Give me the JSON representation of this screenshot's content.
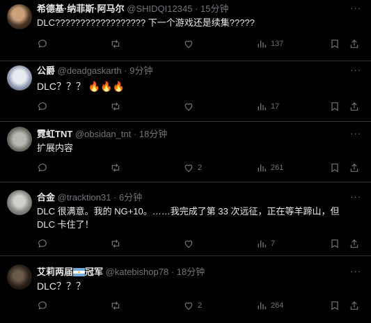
{
  "tweets": [
    {
      "name": "希德基·纳菲斯·阿马尔",
      "handle": "@SHIDQI12345",
      "time": "15分钟",
      "text": "DLC?????????????????? 下一个游戏还是续集?????",
      "reply_count": "",
      "retweet_count": "",
      "like_count": "",
      "view_count": "137"
    },
    {
      "name": "公爵",
      "handle": "@deadgaskarth",
      "time": "9分钟",
      "text": "DLC？？？ 🔥🔥🔥",
      "reply_count": "",
      "retweet_count": "",
      "like_count": "",
      "view_count": "17"
    },
    {
      "name": "霓虹TNT",
      "handle": "@obsidan_tnt",
      "time": "18分钟",
      "text": "扩展内容",
      "reply_count": "",
      "retweet_count": "",
      "like_count": "2",
      "view_count": "261"
    },
    {
      "name": "合金",
      "handle": "@tracktion31",
      "time": "6分钟",
      "text": "DLC 很满意。我的 NG+10。……我完成了第 33 次远征，正在等羊蹄山，但 DLC 卡住了！",
      "reply_count": "",
      "retweet_count": "",
      "like_count": "",
      "view_count": "7"
    },
    {
      "name": "艾莉两届",
      "name_suffix": "冠军",
      "handle": "@katebishop78",
      "time": "18分钟",
      "text": "DLC？？？",
      "reply_count": "",
      "retweet_count": "",
      "like_count": "2",
      "view_count": "264"
    }
  ],
  "dot": "·",
  "more": "···",
  "icons": [
    "reply-icon",
    "retweet-icon",
    "like-icon",
    "views-icon",
    "bookmark-icon",
    "share-icon"
  ],
  "colors": {
    "bg": "#000000",
    "text": "#e7e9ea",
    "muted": "#71767b",
    "divider": "#2f3336"
  }
}
